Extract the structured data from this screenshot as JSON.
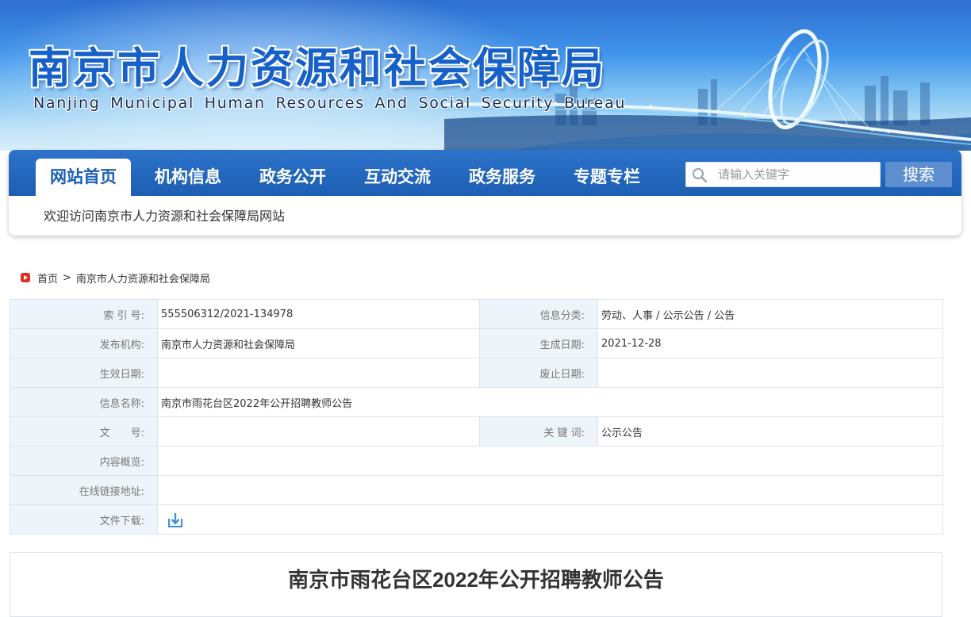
{
  "header": {
    "title_cn": "南京市人力资源和社会保障局",
    "title_en": "Nanjing Municipal Human Resources And Social Security Bureau"
  },
  "nav": {
    "items": [
      {
        "label": "网站首页",
        "active": true
      },
      {
        "label": "机构信息",
        "active": false
      },
      {
        "label": "政务公开",
        "active": false
      },
      {
        "label": "互动交流",
        "active": false
      },
      {
        "label": "政务服务",
        "active": false
      },
      {
        "label": "专题专栏",
        "active": false
      }
    ],
    "search_placeholder": "请输入关键字",
    "search_button": "搜索",
    "welcome": "欢迎访问南京市人力资源和社会保障局网站"
  },
  "breadcrumb": {
    "home": "首页",
    "separator": ">",
    "current": "南京市人力资源和社会保障局"
  },
  "info": {
    "index_no_label": "索 引 号:",
    "index_no": "555506312/2021-134978",
    "category_label": "信息分类:",
    "category": "劳动、人事 / 公示公告 / 公告",
    "publisher_label": "发布机构:",
    "publisher": "南京市人力资源和社会保障局",
    "created_label": "生成日期:",
    "created": "2021-12-28",
    "effective_label": "生效日期:",
    "effective": "",
    "abolished_label": "废止日期:",
    "abolished": "",
    "name_label": "信息名称:",
    "name": "南京市雨花台区2022年公开招聘教师公告",
    "doc_no_label": "文　　号:",
    "doc_no": "",
    "keywords_label": "关 键 词:",
    "keywords": "公示公告",
    "summary_label": "内容概览:",
    "summary": "",
    "link_label": "在线链接地址:",
    "link": "",
    "download_label": "文件下载:"
  },
  "article": {
    "title": "南京市雨花台区2022年公开招聘教师公告"
  },
  "colors": {
    "nav_blue": "#1c5eb4",
    "search_button": "#5d8fd0",
    "label_bg": "#edf5fb",
    "breadcrumb_icon": "#e02e24"
  },
  "icons": {
    "search": "search-icon",
    "breadcrumb": "play-icon",
    "download": "download-icon"
  }
}
